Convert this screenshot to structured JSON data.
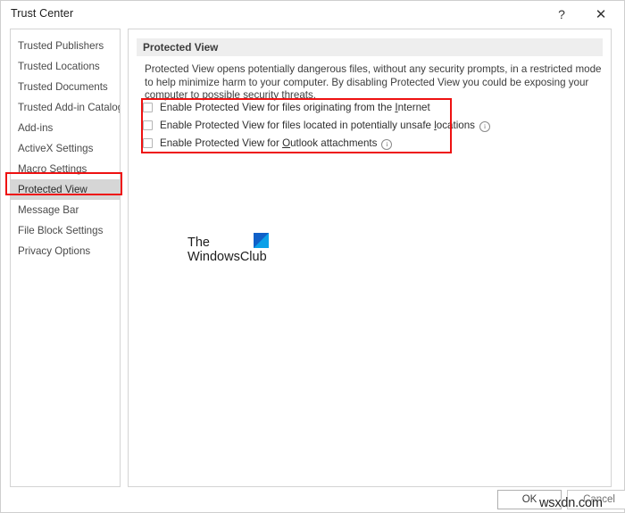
{
  "window": {
    "title": "Trust Center",
    "help_label": "?",
    "close_label": "✕"
  },
  "sidebar": {
    "items": [
      {
        "label": "Trusted Publishers",
        "selected": false
      },
      {
        "label": "Trusted Locations",
        "selected": false
      },
      {
        "label": "Trusted Documents",
        "selected": false
      },
      {
        "label": "Trusted Add-in Catalogs",
        "selected": false
      },
      {
        "label": "Add-ins",
        "selected": false
      },
      {
        "label": "ActiveX Settings",
        "selected": false
      },
      {
        "label": "Macro Settings",
        "selected": false
      },
      {
        "label": "Protected View",
        "selected": true
      },
      {
        "label": "Message Bar",
        "selected": false
      },
      {
        "label": "File Block Settings",
        "selected": false
      },
      {
        "label": "Privacy Options",
        "selected": false
      }
    ]
  },
  "content": {
    "section_title": "Protected View",
    "description": "Protected View opens potentially dangerous files, without any security prompts, in a restricted mode to help minimize harm to your computer. By disabling Protected View you could be exposing your computer to possible security threats.",
    "checkboxes": [
      {
        "label_before": "Enable Protected View for files originating from the ",
        "accelerator": "I",
        "label_after": "nternet",
        "checked": false,
        "has_info_icon": false
      },
      {
        "label_before": "Enable Protected View for files located in potentially unsafe ",
        "accelerator": "l",
        "label_after": "ocations",
        "checked": false,
        "has_info_icon": true
      },
      {
        "label_before": "Enable Protected View for ",
        "accelerator": "O",
        "label_after": "utlook attachments",
        "checked": false,
        "has_info_icon": true
      }
    ],
    "info_icon_glyph": "i"
  },
  "logo": {
    "line1": "The",
    "line2": "WindowsClub"
  },
  "footer": {
    "ok_label": "OK",
    "cancel_label": "Cancel"
  },
  "watermark": {
    "text": "wsxdn.com"
  },
  "colors": {
    "annotation_red": "#ee1111",
    "selection_gray": "#d6d6d6",
    "header_band": "#eeeeee",
    "logo_blue": "#0ba0e8",
    "logo_blue_dark": "#1060c8"
  }
}
